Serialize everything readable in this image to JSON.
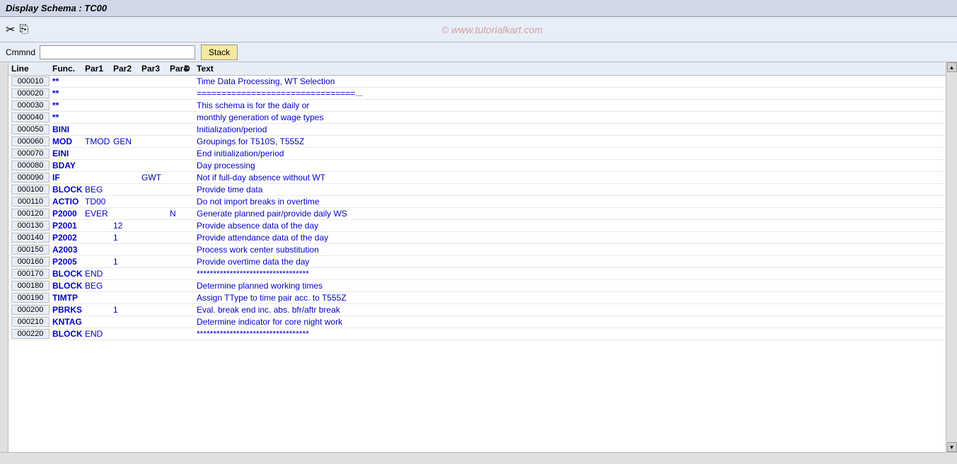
{
  "title": "Display Schema : TC00",
  "watermark": "© www.tutorialkart.com",
  "toolbar": {
    "icons": [
      "scissors-icon",
      "copy-icon"
    ]
  },
  "command": {
    "label": "Cmmnd",
    "placeholder": "",
    "stack_button": "Stack"
  },
  "table": {
    "headers": {
      "line": "Line",
      "func": "Func.",
      "par1": "Par1",
      "par2": "Par2",
      "par3": "Par3",
      "par4": "Par4",
      "d": "D",
      "text": "Text"
    },
    "rows": [
      {
        "line": "000010",
        "func": "**",
        "par1": "",
        "par2": "",
        "par3": "",
        "par4": "",
        "d": "",
        "text": "Time Data Processing, WT Selection"
      },
      {
        "line": "000020",
        "func": "**",
        "par1": "",
        "par2": "",
        "par3": "",
        "par4": "",
        "d": "",
        "text": "================================..."
      },
      {
        "line": "000030",
        "func": "**",
        "par1": "",
        "par2": "",
        "par3": "",
        "par4": "",
        "d": "",
        "text": "This schema is for the daily or"
      },
      {
        "line": "000040",
        "func": "**",
        "par1": "",
        "par2": "",
        "par3": "",
        "par4": "",
        "d": "",
        "text": "monthly generation of wage types"
      },
      {
        "line": "000050",
        "func": "BINI",
        "par1": "",
        "par2": "",
        "par3": "",
        "par4": "",
        "d": "",
        "text": "Initialization/period"
      },
      {
        "line": "000060",
        "func": "MOD",
        "par1": "TMOD",
        "par2": "GEN",
        "par3": "",
        "par4": "",
        "d": "",
        "text": "Groupings for T510S, T555Z"
      },
      {
        "line": "000070",
        "func": "EINI",
        "par1": "",
        "par2": "",
        "par3": "",
        "par4": "",
        "d": "",
        "text": "End initialization/period"
      },
      {
        "line": "000080",
        "func": "BDAY",
        "par1": "",
        "par2": "",
        "par3": "",
        "par4": "",
        "d": "",
        "text": "Day processing"
      },
      {
        "line": "000090",
        "func": "IF",
        "par1": "",
        "par2": "",
        "par3": "GWT",
        "par4": "",
        "d": "",
        "text": "Not if full-day absence without WT"
      },
      {
        "line": "000100",
        "func": "BLOCK",
        "par1": "BEG",
        "par2": "",
        "par3": "",
        "par4": "",
        "d": "",
        "text": "Provide time data"
      },
      {
        "line": "000110",
        "func": "ACTIO",
        "par1": "TD00",
        "par2": "",
        "par3": "",
        "par4": "",
        "d": "",
        "text": "Do not import breaks in overtime"
      },
      {
        "line": "000120",
        "func": "P2000",
        "par1": "EVER",
        "par2": "",
        "par3": "",
        "par4": "N",
        "d": "",
        "text": "Generate planned pair/provide daily WS"
      },
      {
        "line": "000130",
        "func": "P2001",
        "par1": "",
        "par2": "12",
        "par3": "",
        "par4": "",
        "d": "",
        "text": "Provide absence data of the day"
      },
      {
        "line": "000140",
        "func": "P2002",
        "par1": "",
        "par2": "1",
        "par3": "",
        "par4": "",
        "d": "",
        "text": "Provide attendance data of the day"
      },
      {
        "line": "000150",
        "func": "A2003",
        "par1": "",
        "par2": "",
        "par3": "",
        "par4": "",
        "d": "",
        "text": "Process work center substitution"
      },
      {
        "line": "000160",
        "func": "P2005",
        "par1": "",
        "par2": "1",
        "par3": "",
        "par4": "",
        "d": "",
        "text": "Provide overtime data the day"
      },
      {
        "line": "000170",
        "func": "BLOCK",
        "par1": "END",
        "par2": "",
        "par3": "",
        "par4": "",
        "d": "",
        "text": "**********************************"
      },
      {
        "line": "000180",
        "func": "BLOCK",
        "par1": "BEG",
        "par2": "",
        "par3": "",
        "par4": "",
        "d": "",
        "text": "Determine planned working times"
      },
      {
        "line": "000190",
        "func": "TIMTP",
        "par1": "",
        "par2": "",
        "par3": "",
        "par4": "",
        "d": "",
        "text": "Assign TType to time pair acc. to T555Z"
      },
      {
        "line": "000200",
        "func": "PBRKS",
        "par1": "",
        "par2": "1",
        "par3": "",
        "par4": "",
        "d": "",
        "text": "Eval. break end inc. abs. bfr/aftr break"
      },
      {
        "line": "000210",
        "func": "KNTAG",
        "par1": "",
        "par2": "",
        "par3": "",
        "par4": "",
        "d": "",
        "text": "Determine indicator for core night work"
      },
      {
        "line": "000220",
        "func": "BLOCK",
        "par1": "END",
        "par2": "",
        "par3": "",
        "par4": "",
        "d": "",
        "text": "**********************************"
      }
    ]
  }
}
